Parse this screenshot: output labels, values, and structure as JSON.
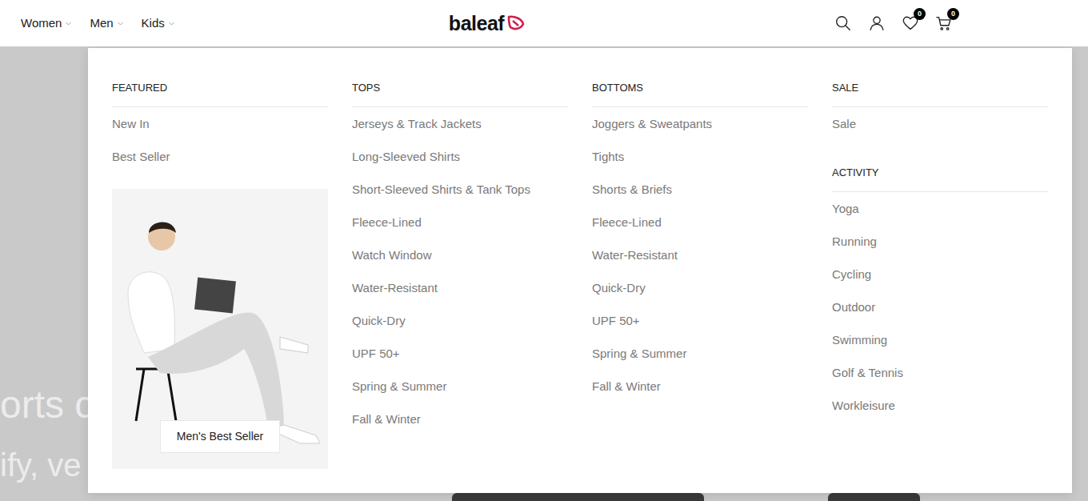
{
  "nav": [
    {
      "label": "Women"
    },
    {
      "label": "Men"
    },
    {
      "label": "Kids"
    }
  ],
  "logo": {
    "text": "baleaf"
  },
  "header": {
    "wishlist_count": "0",
    "cart_count": "0"
  },
  "hero": {
    "lines": [
      "orts c",
      "ify, ve"
    ]
  },
  "menu": {
    "columns": [
      {
        "sections": [
          {
            "heading": "FEATURED",
            "items": [
              "New In",
              "Best Seller"
            ]
          }
        ],
        "promo": {
          "button": "Men's Best Seller"
        }
      },
      {
        "sections": [
          {
            "heading": "TOPS",
            "items": [
              "Jerseys & Track Jackets",
              "Long-Sleeved Shirts",
              "Short-Sleeved Shirts & Tank Tops",
              "Fleece-Lined",
              "Watch Window",
              "Water-Resistant",
              "Quick-Dry",
              "UPF 50+",
              "Spring & Summer",
              "Fall & Winter"
            ]
          }
        ]
      },
      {
        "sections": [
          {
            "heading": "BOTTOMS",
            "items": [
              "Joggers & Sweatpants",
              "Tights",
              "Shorts & Briefs",
              "Fleece-Lined",
              "Water-Resistant",
              "Quick-Dry",
              "UPF 50+",
              "Spring & Summer",
              "Fall & Winter"
            ]
          }
        ]
      },
      {
        "sections": [
          {
            "heading": "SALE",
            "items": [
              "Sale"
            ]
          },
          {
            "heading": "ACTIVITY",
            "items": [
              "Yoga",
              "Running",
              "Cycling",
              "Outdoor",
              "Swimming",
              "Golf & Tennis",
              "Workleisure"
            ]
          }
        ]
      }
    ]
  }
}
